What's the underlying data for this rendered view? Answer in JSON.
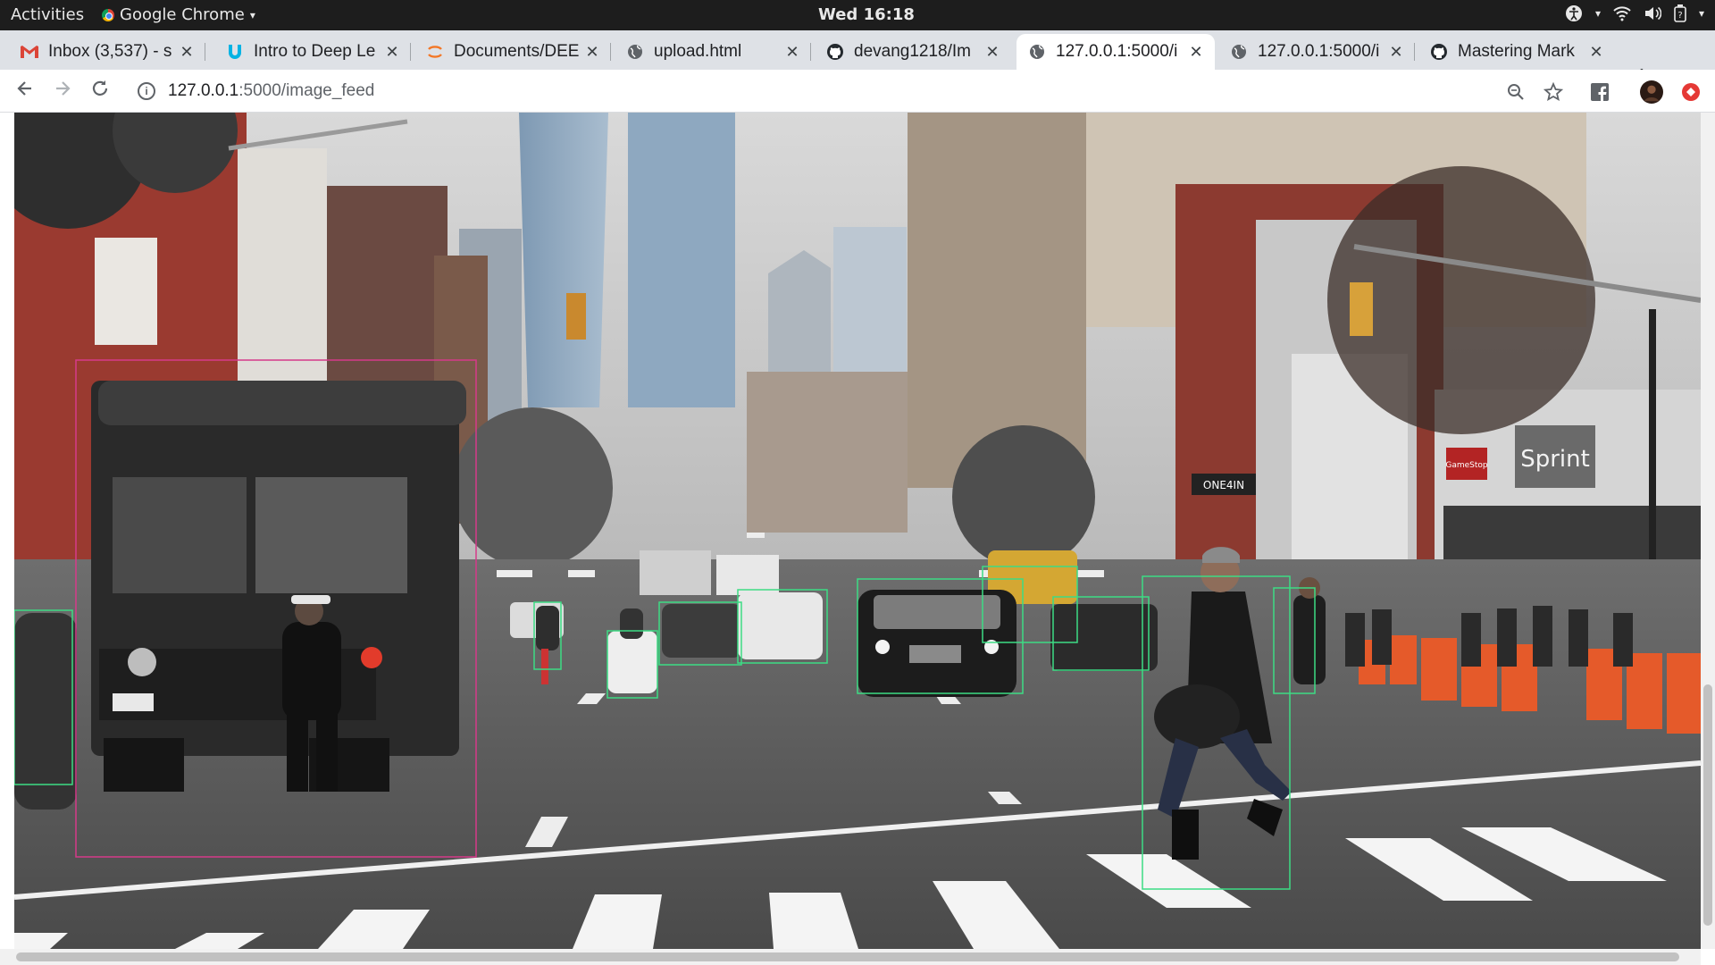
{
  "topbar": {
    "activities": "Activities",
    "app_name": "Google Chrome",
    "clock": "Wed 16:18"
  },
  "tabs": [
    {
      "title": "Inbox (3,537) - s",
      "icon": "gmail-icon",
      "active": false
    },
    {
      "title": "Intro to Deep Le",
      "icon": "udacity-icon",
      "active": false
    },
    {
      "title": "Documents/DEE",
      "icon": "jupyter-icon",
      "active": false
    },
    {
      "title": "upload.html",
      "icon": "globe-icon",
      "active": false
    },
    {
      "title": "devang1218/Im",
      "icon": "github-icon",
      "active": false
    },
    {
      "title": "127.0.0.1:5000/i",
      "icon": "globe-icon",
      "active": true
    },
    {
      "title": "127.0.0.1:5000/i",
      "icon": "globe-icon",
      "active": false
    },
    {
      "title": "Mastering Mark",
      "icon": "github-icon",
      "active": false
    }
  ],
  "address_bar": {
    "host": "127.0.0.1",
    "path": ":5000/image_feed"
  },
  "image_feed": {
    "description_label": "image feed",
    "sign_text": "ONE4IN",
    "store_sign": "Sprint",
    "gamestop_sign": "GameStop",
    "detection_colors": {
      "truck": "#d63a8a",
      "person": "#3ddc84",
      "car": "#3ddc84"
    },
    "detection_count": 10
  }
}
